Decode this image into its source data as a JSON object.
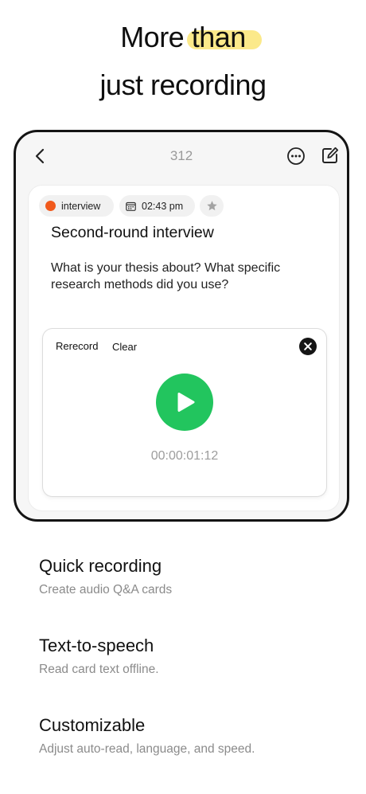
{
  "headline": {
    "line1_prefix": "More ",
    "line1_highlight": "than",
    "line2": "just recording",
    "highlight_color": "#fbe98a"
  },
  "device": {
    "navbar": {
      "back_icon": "chevron-left-icon",
      "title": "312",
      "more_icon": "ellipsis-circle-icon",
      "edit_icon": "compose-icon"
    },
    "card": {
      "tag": {
        "label": "interview",
        "color": "#f15a1d"
      },
      "time": {
        "icon": "calendar-icon",
        "value": "02:43 pm"
      },
      "star_icon": "star-icon",
      "title": "Second-round interview",
      "question": "What is your thesis about? What specific research methods did you use?",
      "player": {
        "rerecord_label": "Rerecord",
        "clear_label": "Clear",
        "close_icon": "close-icon",
        "play_icon": "play-icon",
        "play_color": "#22c55e",
        "elapsed": "00:00:01:12"
      }
    }
  },
  "features": [
    {
      "title": "Quick recording",
      "subtitle": "Create audio Q&A cards"
    },
    {
      "title": "Text-to-speech",
      "subtitle": "Read card text offline."
    },
    {
      "title": "Customizable",
      "subtitle": "Adjust auto-read, language, and speed."
    }
  ]
}
